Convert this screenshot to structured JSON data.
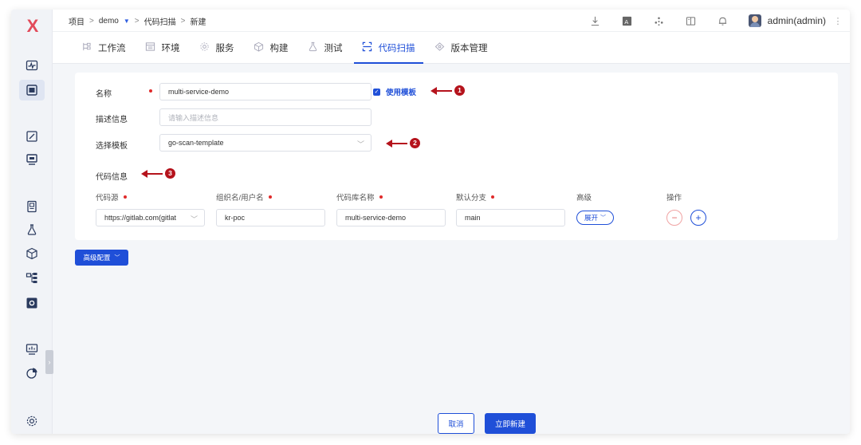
{
  "app": {
    "logo_glyph": "X",
    "brand_color": "#e24a5a",
    "accent_color": "#1f4fd8"
  },
  "breadcrumb": {
    "project": "项目",
    "project_name": "demo",
    "module": "代码扫描",
    "action": "新建",
    "separator": ">"
  },
  "header": {
    "icons": [
      "download-icon",
      "translate-icon",
      "plugin-icon",
      "docs-icon",
      "bell-icon"
    ],
    "user_name": "admin(admin)"
  },
  "tabs": [
    {
      "label": "工作流",
      "icon": "workflow-icon"
    },
    {
      "label": "环境",
      "icon": "environment-icon"
    },
    {
      "label": "服务",
      "icon": "service-icon"
    },
    {
      "label": "构建",
      "icon": "build-icon"
    },
    {
      "label": "测试",
      "icon": "test-icon"
    },
    {
      "label": "代码扫描",
      "icon": "scan-icon",
      "active": true
    },
    {
      "label": "版本管理",
      "icon": "version-icon"
    }
  ],
  "form": {
    "name_label": "名称",
    "name_value": "multi-service-demo",
    "use_template_label": "使用模板",
    "use_template_checked": true,
    "desc_label": "描述信息",
    "desc_placeholder": "请输入描述信息",
    "template_label": "选择模板",
    "template_value": "go-scan-template",
    "code_info_label": "代码信息",
    "columns": {
      "source": "代码源",
      "org": "组织名/用户名",
      "repo": "代码库名称",
      "branch": "默认分支",
      "advanced": "高级",
      "ops": "操作"
    },
    "repo_row": {
      "source": "https://gitlab.com(gitlat",
      "org": "kr-poc",
      "repo": "multi-service-demo",
      "branch": "main",
      "expand_label": "展开",
      "remove_glyph": "−",
      "add_glyph": "+"
    }
  },
  "annotations": [
    "1",
    "2",
    "3"
  ],
  "advanced_config_label": "高级配置",
  "footer": {
    "cancel_label": "取消",
    "create_label": "立即新建"
  }
}
